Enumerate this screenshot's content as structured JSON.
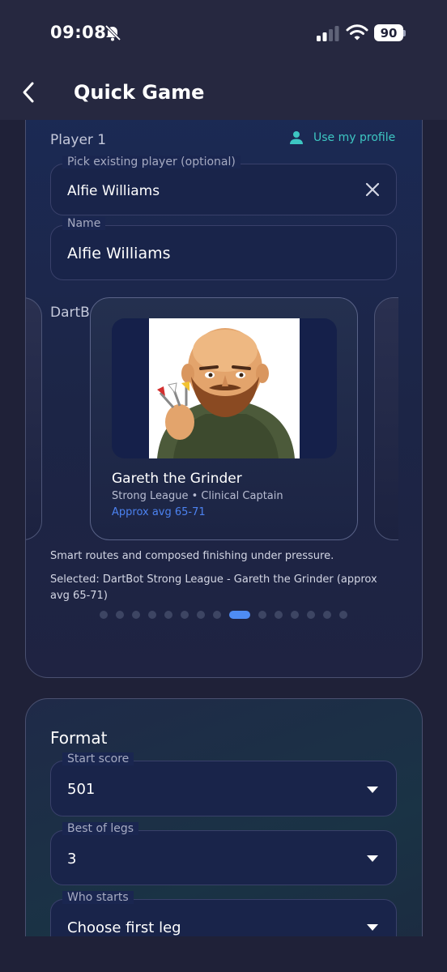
{
  "status_bar": {
    "time": "09:08",
    "battery": "90"
  },
  "app_bar": {
    "title": "Quick Game"
  },
  "player": {
    "section_label": "Player 1",
    "use_profile_label": "Use my profile",
    "pick_field": {
      "label": "Pick existing player (optional)",
      "value": "Alfie Williams"
    },
    "name_field": {
      "label": "Name",
      "value": "Alfie Williams"
    }
  },
  "dartbot": {
    "section_label": "DartBot",
    "selected_card": {
      "name": "Gareth the Grinder",
      "league": "Strong League • Clinical Captain",
      "avg": "Approx avg 65-71"
    },
    "description": "Smart routes and composed finishing under pressure.",
    "selected_text": "Selected: DartBot Strong League - Gareth the Grinder (approx avg 65-71)",
    "dots_total": 16,
    "dots_active_index": 8
  },
  "format": {
    "title": "Format",
    "start_score": {
      "label": "Start score",
      "value": "501"
    },
    "best_of_legs": {
      "label": "Best of legs",
      "value": "3"
    },
    "who_starts": {
      "label": "Who starts",
      "value": "Choose first leg"
    }
  },
  "colors": {
    "accent": "#4e8cf4",
    "link": "#3dc6c2",
    "background": "#1f2138"
  }
}
